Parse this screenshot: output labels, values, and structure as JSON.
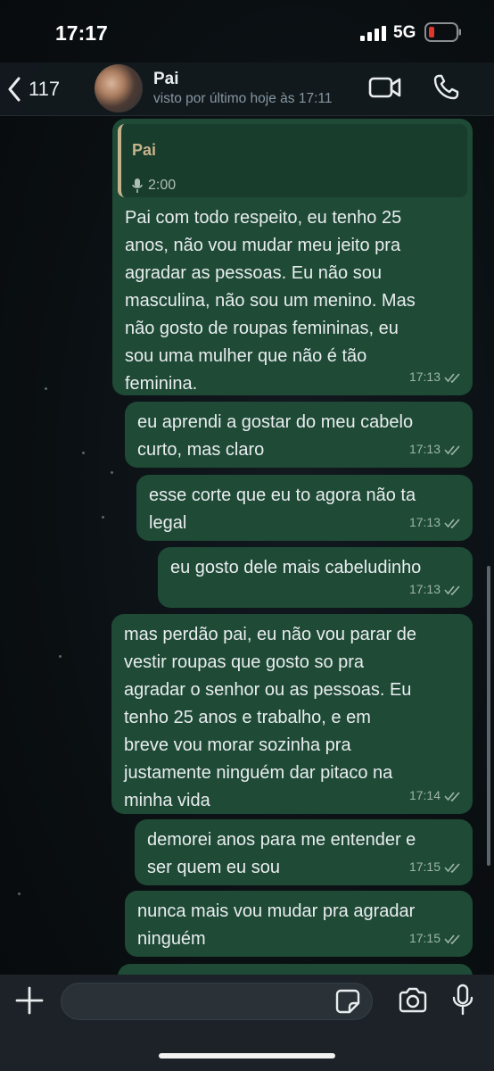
{
  "status_bar": {
    "time": "17:17",
    "network": "5G"
  },
  "header": {
    "back_count": "117",
    "contact_name": "Pai",
    "contact_status": "visto por último hoje às 17:11"
  },
  "messages": [
    {
      "quote": {
        "author": "Pai",
        "duration": "2:00"
      },
      "text": "Pai com todo respeito, eu tenho 25\nanos, não vou mudar meu jeito pra\nagradar as pessoas. Eu não sou\nmasculina, não sou um menino. Mas\nnão gosto de roupas femininas, eu\nsou uma mulher que não é tão\nfeminina.",
      "time": "17:13"
    },
    {
      "text": "eu aprendi a gostar do meu cabelo\ncurto, mas claro",
      "time": "17:13"
    },
    {
      "text": "esse corte que eu to agora não ta\nlegal",
      "time": "17:13"
    },
    {
      "text": "eu gosto dele mais cabeludinho",
      "time": "17:13"
    },
    {
      "text": "mas perdão pai, eu não vou parar de\nvestir roupas que gosto so pra\nagradar o senhor ou as pessoas. Eu\ntenho 25 anos e trabalho, e em\nbreve vou morar sozinha pra\njustamente ninguém dar pitaco na\nminha vida",
      "time": "17:14"
    },
    {
      "text": "demorei anos para me entender e\nser quem eu sou",
      "time": "17:15"
    },
    {
      "text": "nunca mais vou mudar pra agradar\nninguém",
      "time": "17:15"
    }
  ],
  "input": {
    "placeholder": ""
  },
  "colors": {
    "outgoing_bubble": "#1e4a36",
    "quote_accent": "#c7b38a",
    "read_ticks": "#9db5a8",
    "battery_low": "#e0362c"
  },
  "icons": [
    "back-chevron",
    "video-camera",
    "phone",
    "plus",
    "sticker",
    "camera",
    "microphone",
    "double-check",
    "microphone-small"
  ]
}
